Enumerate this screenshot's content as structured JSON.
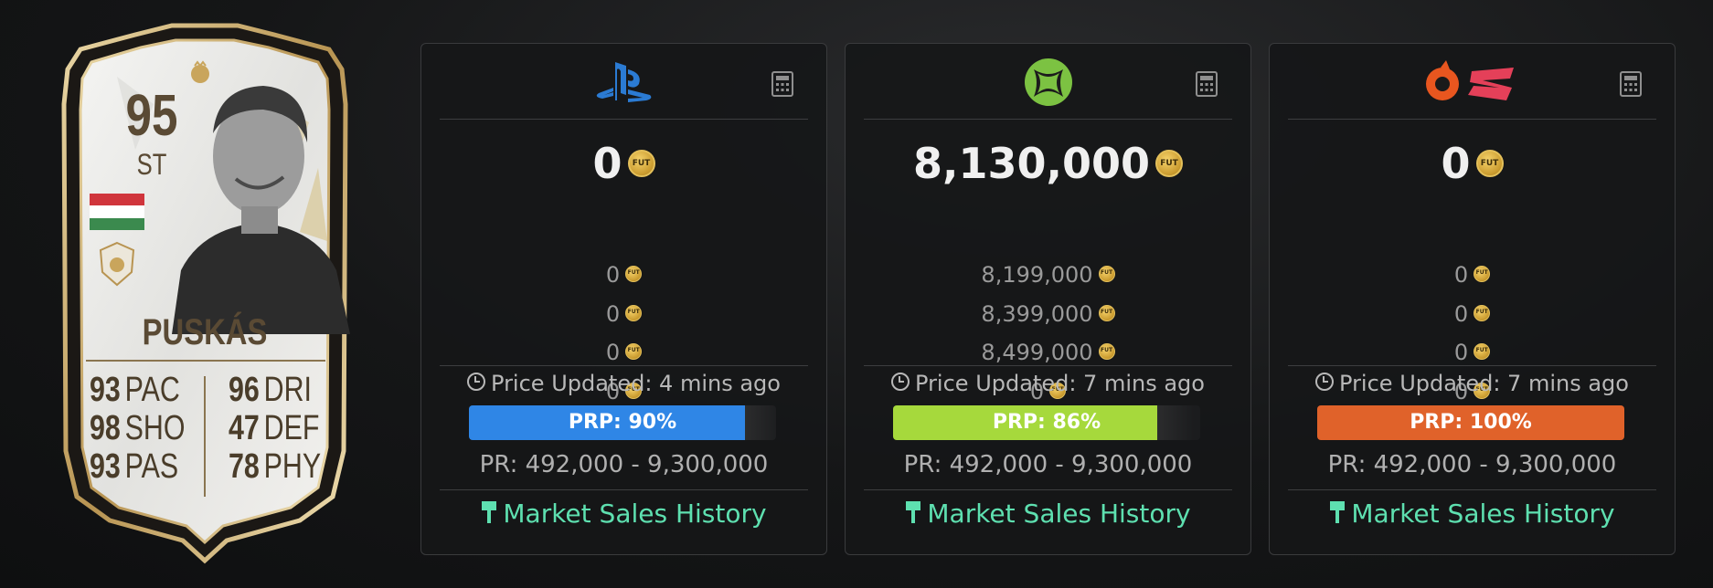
{
  "player": {
    "rating": "95",
    "position": "ST",
    "name": "PUSKÁS",
    "stats_left": [
      {
        "value": "93",
        "label": "PAC"
      },
      {
        "value": "98",
        "label": "SHO"
      },
      {
        "value": "93",
        "label": "PAS"
      }
    ],
    "stats_right": [
      {
        "value": "96",
        "label": "DRI"
      },
      {
        "value": "47",
        "label": "DEF"
      },
      {
        "value": "78",
        "label": "PHY"
      }
    ],
    "nation_flag": "hungary-flag-icon",
    "club_badge": "icons-badge-icon"
  },
  "coin_label": "FUT",
  "panels": [
    {
      "platform": "PlayStation",
      "platform_icon": "playstation-icon",
      "main_price": "0",
      "prices": [
        "0",
        "0",
        "0",
        "0"
      ],
      "updated": "Price Updated: 4 mins ago",
      "prp_label": "PRP: 90%",
      "prp_percent": 90,
      "prp_color": "#2f86e6",
      "range": "PR: 492,000 - 9,300,000",
      "history_label": "Market Sales History"
    },
    {
      "platform": "Xbox",
      "platform_icon": "xbox-icon",
      "main_price": "8,130,000",
      "prices": [
        "8,199,000",
        "8,399,000",
        "8,499,000",
        "0"
      ],
      "updated": "Price Updated: 7 mins ago",
      "prp_label": "PRP: 86%",
      "prp_percent": 86,
      "prp_color": "#a6d93c",
      "range": "PR: 492,000 - 9,300,000",
      "history_label": "Market Sales History"
    },
    {
      "platform": "PC / Stadia",
      "platform_icon": "origin-stadia-icon",
      "main_price": "0",
      "prices": [
        "0",
        "0",
        "0",
        "0"
      ],
      "updated": "Price Updated: 7 mins ago",
      "prp_label": "PRP: 100%",
      "prp_percent": 100,
      "prp_color": "#e0622a",
      "range": "PR: 492,000 - 9,300,000",
      "history_label": "Market Sales History"
    }
  ]
}
